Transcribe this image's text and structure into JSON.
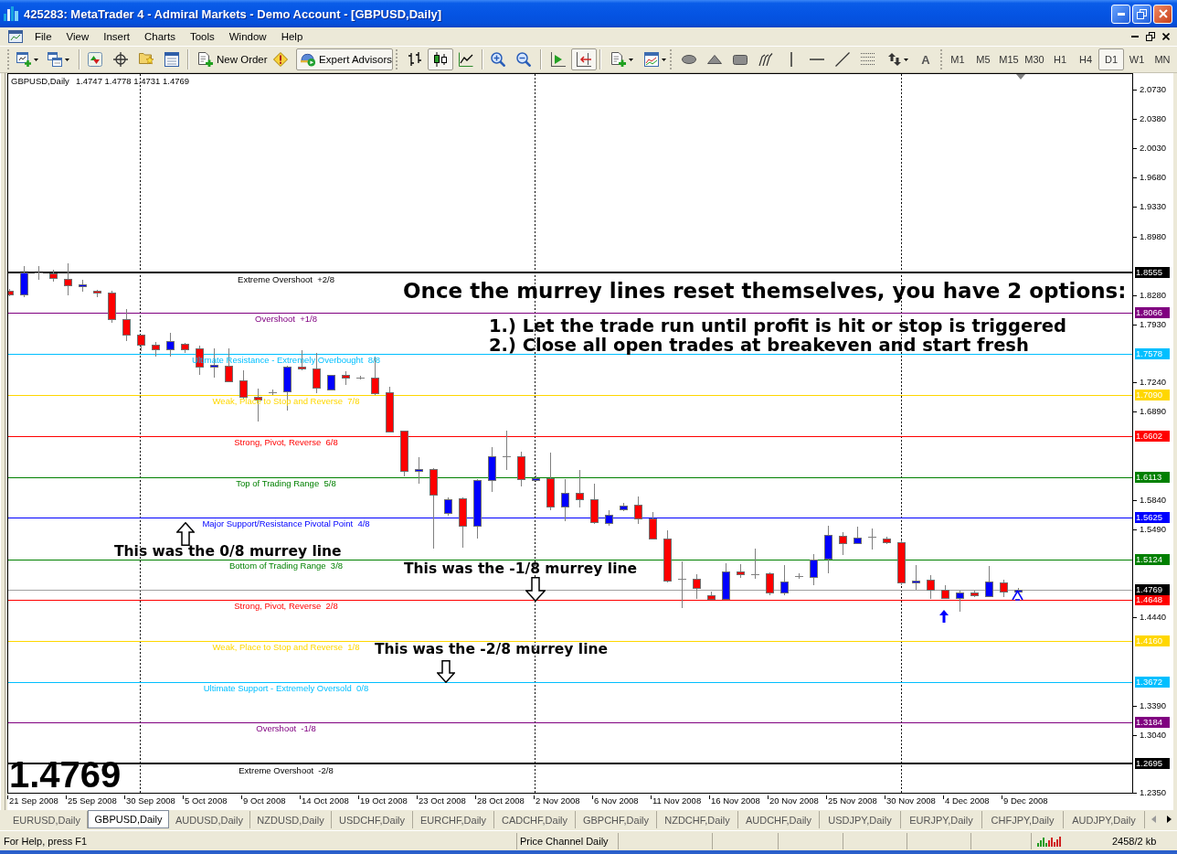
{
  "window": {
    "title": "425283: MetaTrader 4 - Admiral Markets - Demo Account - [GBPUSD,Daily]"
  },
  "menu": [
    "File",
    "View",
    "Insert",
    "Charts",
    "Tools",
    "Window",
    "Help"
  ],
  "toolbar": {
    "new_order": {
      "label": "New Order"
    },
    "expert_advisors": {
      "label": "Expert Advisors",
      "pressed": true
    },
    "chart_types": [
      {
        "selected": false
      },
      {
        "selected": true
      },
      {
        "selected": false
      }
    ],
    "auto_scroll": {
      "pressed": false
    },
    "chart_shift": {
      "pressed": true
    },
    "text_tool": {
      "label": "A"
    },
    "timeframes": [
      {
        "label": "M1",
        "selected": false
      },
      {
        "label": "M5",
        "selected": false
      },
      {
        "label": "M15",
        "selected": false
      },
      {
        "label": "M30",
        "selected": false
      },
      {
        "label": "H1",
        "selected": false
      },
      {
        "label": "H4",
        "selected": false
      },
      {
        "label": "D1",
        "selected": true
      },
      {
        "label": "W1",
        "selected": false
      },
      {
        "label": "MN",
        "selected": false
      }
    ]
  },
  "chart": {
    "title": "GBPUSD,Daily",
    "ohlc": "1.4747 1.4778 1.4731 1.4769",
    "price_scale": [
      "2.0730",
      "2.0380",
      "2.0030",
      "1.9680",
      "1.9330",
      "1.8980",
      "1.8280",
      "1.7930",
      "1.7240",
      "1.6890",
      "1.5840",
      "1.5490",
      "1.4440",
      "1.3390",
      "1.3040",
      "1.2350"
    ],
    "time_scale": [
      "21 Sep 2008",
      "25 Sep 2008",
      "30 Sep 2008",
      "5 Oct 2008",
      "9 Oct 2008",
      "14 Oct 2008",
      "19 Oct 2008",
      "23 Oct 2008",
      "28 Oct 2008",
      "2 Nov 2008",
      "6 Nov 2008",
      "11 Nov 2008",
      "16 Nov 2008",
      "20 Nov 2008",
      "25 Nov 2008",
      "30 Nov 2008",
      "4 Dec 2008",
      "9 Dec 2008"
    ],
    "levels": [
      {
        "label": "Extreme Overshoot  +2/8",
        "price": "1.8555",
        "color": "#000000",
        "kind": "heavy"
      },
      {
        "label": "Overshoot  +1/8",
        "price": "1.8066",
        "color": "#800080",
        "kind": "plain"
      },
      {
        "label": "Ultimate Resistance - Extremely Overbought  8/8",
        "price": "1.7578",
        "color": "#00bfff",
        "kind": "plain"
      },
      {
        "label": "Weak, Place to Stop and Reverse  7/8",
        "price": "1.7090",
        "color": "#ffd700",
        "kind": "plain"
      },
      {
        "label": "Strong, Pivot, Reverse  6/8",
        "price": "1.6602",
        "color": "#ff0000",
        "kind": "plain"
      },
      {
        "label": "Top of Trading Range  5/8",
        "price": "1.6113",
        "color": "#008000",
        "kind": "plain"
      },
      {
        "label": "Major Support/Resistance Pivotal Point  4/8",
        "price": "1.5625",
        "color": "#0000ff",
        "kind": "plain"
      },
      {
        "label": "Bottom of Trading Range  3/8",
        "price": "1.5124",
        "color": "#008000",
        "kind": "plain"
      },
      {
        "label": "Strong, Pivot, Reverse  2/8",
        "price": "1.4648",
        "color": "#ff0000",
        "kind": "plain"
      },
      {
        "label": "Weak, Place to Stop and Reverse  1/8",
        "price": "1.4160",
        "color": "#ffd700",
        "kind": "plain"
      },
      {
        "label": "Ultimate Support - Extremely Oversold  0/8",
        "price": "1.3672",
        "color": "#00bfff",
        "kind": "plain"
      },
      {
        "label": "Overshoot  -1/8",
        "price": "1.3184",
        "color": "#800080",
        "kind": "plain"
      },
      {
        "label": "Extreme Overshoot  -2/8",
        "price": "1.2695",
        "color": "#000000",
        "kind": "heavy"
      }
    ],
    "bid": {
      "price": "1.4769"
    },
    "last_price": "1.4769",
    "notes": [
      {
        "kind": "heading",
        "text": "Once the murrey lines reset themselves, you have 2 options:"
      },
      {
        "kind": "option",
        "text": "1.) Let the trade run until profit is hit or stop is triggered"
      },
      {
        "kind": "option",
        "text": "2.) Close all open trades at breakeven and start fresh"
      },
      {
        "kind": "callout",
        "text": "This was the 0/8 murrey line"
      },
      {
        "kind": "callout",
        "text": "This was the -1/8 murrey line"
      },
      {
        "kind": "callout",
        "text": "This was the -2/8 murrey line"
      }
    ]
  },
  "tabs": [
    {
      "label": "EURUSD,Daily",
      "selected": false
    },
    {
      "label": "GBPUSD,Daily",
      "selected": true
    },
    {
      "label": "AUDUSD,Daily",
      "selected": false
    },
    {
      "label": "NZDUSD,Daily",
      "selected": false
    },
    {
      "label": "USDCHF,Daily",
      "selected": false
    },
    {
      "label": "EURCHF,Daily",
      "selected": false
    },
    {
      "label": "CADCHF,Daily",
      "selected": false
    },
    {
      "label": "GBPCHF,Daily",
      "selected": false
    },
    {
      "label": "NZDCHF,Daily",
      "selected": false
    },
    {
      "label": "AUDCHF,Daily",
      "selected": false
    },
    {
      "label": "USDJPY,Daily",
      "selected": false
    },
    {
      "label": "EURJPY,Daily",
      "selected": false
    },
    {
      "label": "CHFJPY,Daily",
      "selected": false
    },
    {
      "label": "AUDJPY,Daily",
      "selected": false
    }
  ],
  "status_bar": {
    "help": "For Help, press F1",
    "indicator": "Price Channel Daily",
    "traffic": "2458/2 kb"
  }
}
